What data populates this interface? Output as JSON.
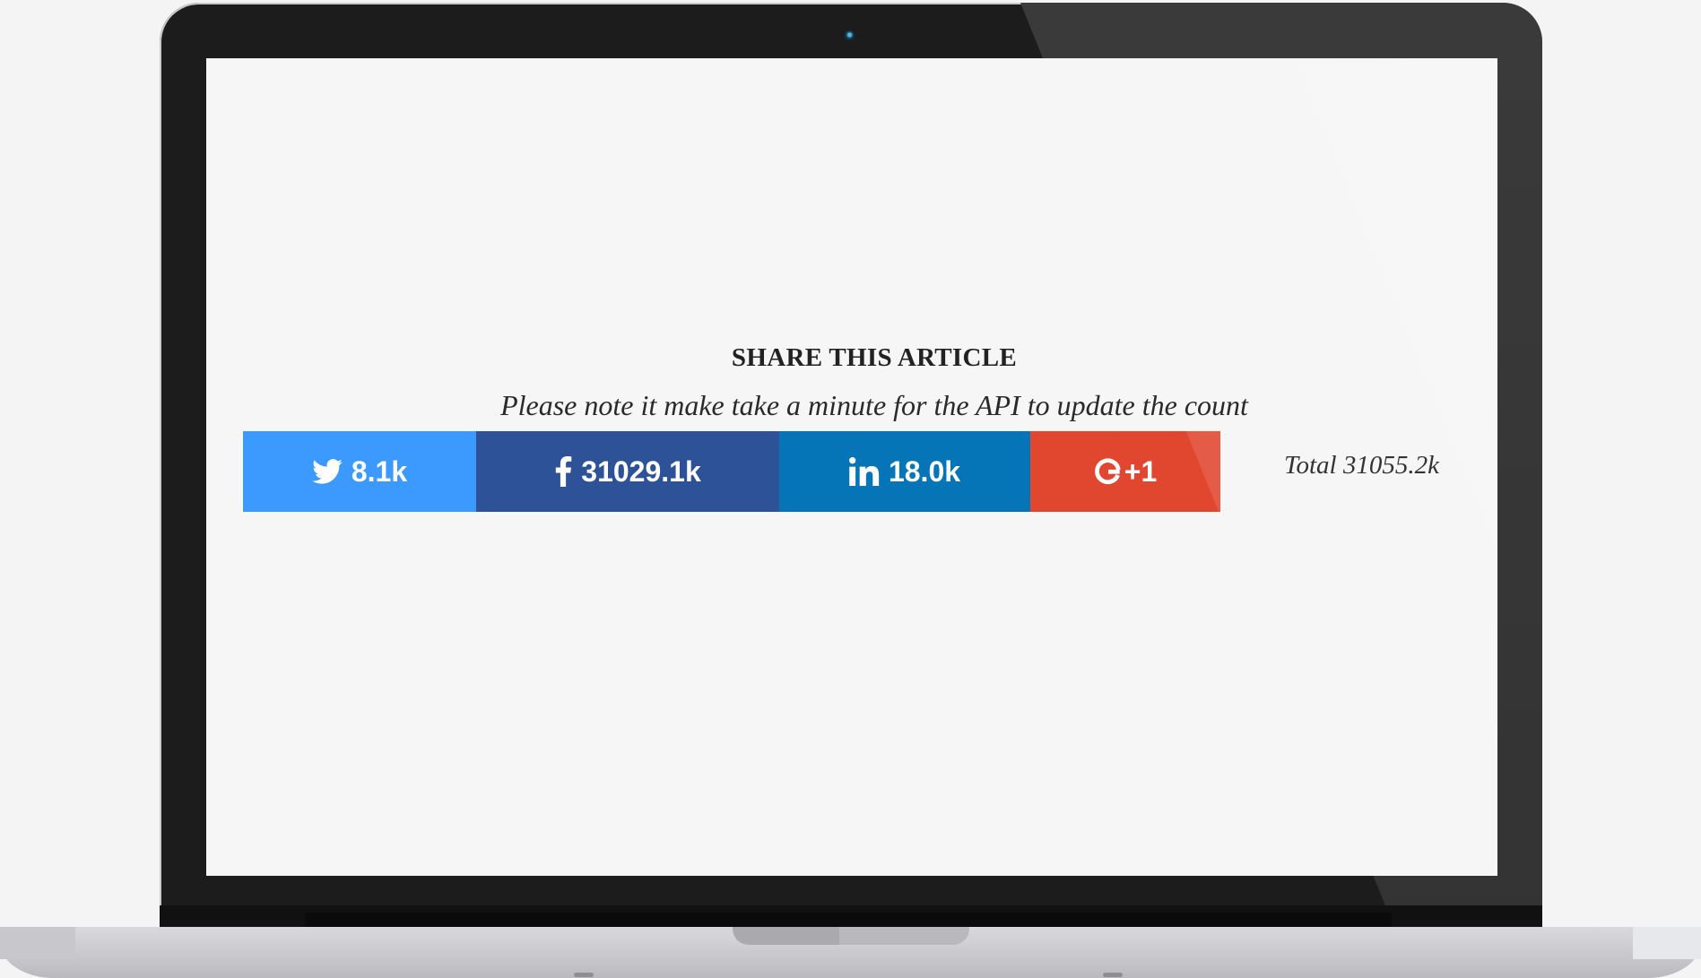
{
  "share": {
    "title": "SHARE THIS ARTICLE",
    "note": "Please note it make take a minute for the API to update the count",
    "buttons": {
      "twitter": {
        "count": "8.1k",
        "icon": "twitter-bird-icon",
        "color": "#3c99fd"
      },
      "facebook": {
        "count": "31029.1k",
        "icon": "facebook-f-icon",
        "color": "#2e5297"
      },
      "linkedin": {
        "count": "18.0k",
        "icon": "linkedin-in-icon",
        "color": "#0675b7"
      },
      "gplus": {
        "label": "+1",
        "icon": "google-g-icon",
        "color": "#e1462f"
      }
    },
    "total": "Total 31055.2k"
  }
}
